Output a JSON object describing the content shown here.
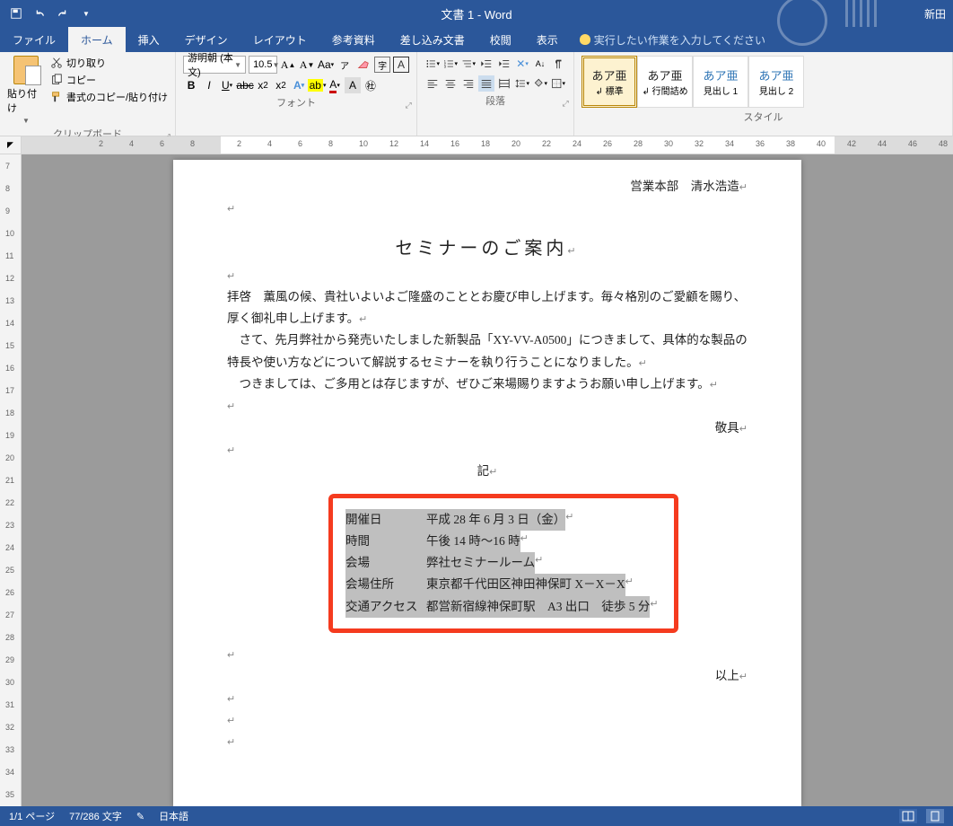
{
  "window": {
    "title": "文書 1 - Word",
    "user": "新田"
  },
  "tabs": [
    "ファイル",
    "ホーム",
    "挿入",
    "デザイン",
    "レイアウト",
    "参考資料",
    "差し込み文書",
    "校閲",
    "表示"
  ],
  "tellme": "実行したい作業を入力してください",
  "clipboard": {
    "paste": "貼り付け",
    "cut": "切り取り",
    "copy": "コピー",
    "format": "書式のコピー/貼り付け",
    "label": "クリップボード"
  },
  "font": {
    "name": "游明朝 (本文)",
    "size": "10.5",
    "label": "フォント"
  },
  "paragraph": {
    "label": "段落"
  },
  "styles": {
    "label": "スタイル",
    "items": [
      {
        "sample": "あア亜",
        "name": "標準",
        "sel": true
      },
      {
        "sample": "あア亜",
        "name": "行間詰め"
      },
      {
        "sample": "あア亜",
        "name": "見出し 1",
        "h": true
      },
      {
        "sample": "あア亜",
        "name": "見出し 2",
        "h": true
      }
    ]
  },
  "ruler": {
    "neg": [
      "8",
      "6",
      "4",
      "2"
    ],
    "pos": [
      "2",
      "4",
      "6",
      "8",
      "10",
      "12",
      "14",
      "16",
      "18",
      "20",
      "22",
      "24",
      "26",
      "28",
      "30",
      "32",
      "34",
      "36",
      "38",
      "40",
      "42",
      "44",
      "46",
      "48"
    ]
  },
  "vruler": [
    "7",
    "8",
    "9",
    "10",
    "11",
    "12",
    "13",
    "14",
    "15",
    "16",
    "17",
    "18",
    "19",
    "20",
    "21",
    "22",
    "23",
    "24",
    "25",
    "26",
    "27",
    "28",
    "29",
    "30",
    "31",
    "32",
    "33",
    "34",
    "35"
  ],
  "doc": {
    "sender": "営業本部　清水浩造",
    "title": "セミナーのご案内",
    "p1a": "拝啓　薫風の候、貴社いよいよご隆盛のこととお慶び申し上げます。毎々格別のご愛顧を賜り、厚く御礼申し上げます。",
    "p2": "　さて、先月弊社から発売いたしました新製品「XY-VV-A0500」につきまして、具体的な製品の特長や使い方などについて解説するセミナーを執り行うことになりました。",
    "p3": "　つきましては、ご多用とは存じますが、ぜひご来場賜りますようお願い申し上げます。",
    "keigu": "敬具",
    "ki": "記",
    "rows": [
      {
        "lab": "開催日",
        "val": "平成 28 年 6 月 3 日（金）"
      },
      {
        "lab": "時間",
        "val": "午後 14 時～16 時"
      },
      {
        "lab": "会場",
        "val": "弊社セミナールーム"
      },
      {
        "lab": "会場住所",
        "val": "東京都千代田区神田神保町 X－X－X"
      },
      {
        "lab": "交通アクセス",
        "val": "都営新宿線神保町駅　A3 出口　徒歩 5 分"
      }
    ],
    "ijo": "以上"
  },
  "status": {
    "page": "1/1 ページ",
    "words": "77/286 文字",
    "lang": "日本語"
  }
}
